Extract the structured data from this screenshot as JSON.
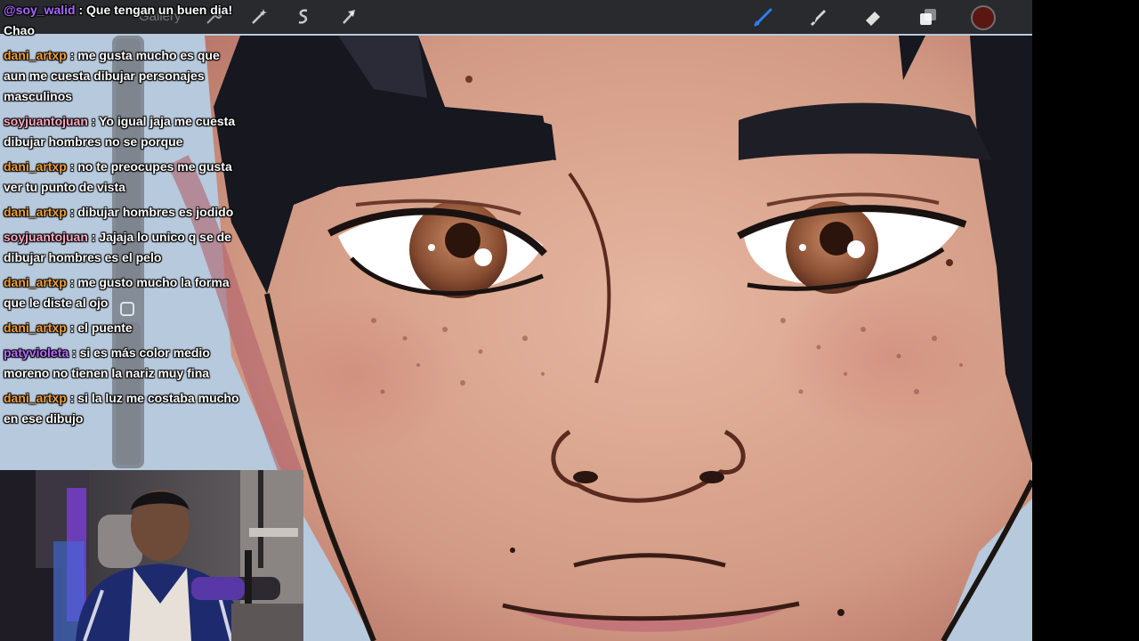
{
  "toolbar": {
    "gallery_label": "Gallery",
    "left_icons": [
      "wrench-icon",
      "magic-wand-icon",
      "selection-icon",
      "transform-arrow-icon"
    ],
    "right_icons": [
      "brush-icon",
      "smudge-icon",
      "eraser-icon",
      "layers-icon"
    ],
    "current_color": "#5a1610",
    "active_tool_color": "#2f7cf6"
  },
  "chat": {
    "messages": [
      {
        "user": "@soy_walid",
        "color": "#a968ff",
        "text": ": Que tengan un buen dia! Chao"
      },
      {
        "user": "dani_artxp",
        "color": "#f2a13a",
        "text": ": me gusta mucho es que aun me cuesta dibujar personajes masculinos"
      },
      {
        "user": "soyjuantojuan",
        "color": "#ffa9c4",
        "text": ": Yo igual jaja me cuesta dibujar hombres no se porque"
      },
      {
        "user": "dani_artxp",
        "color": "#f2a13a",
        "text": ": no te preocupes me gusta ver tu punto de vista"
      },
      {
        "user": "dani_artxp",
        "color": "#f2a13a",
        "text": ": dibujar hombres es jodido"
      },
      {
        "user": "soyjuantojuan",
        "color": "#ffa9c4",
        "text": ": Jajaja lo unico q se de dibujar hombres es el pelo"
      },
      {
        "user": "dani_artxp",
        "color": "#f2a13a",
        "text": ": me gusto mucho la forma que le diste al ojo"
      },
      {
        "user": "dani_artxp",
        "color": "#f2a13a",
        "text": ": el puente"
      },
      {
        "user": "patyvioleta",
        "color": "#b86bff",
        "text": ": si es más color medio moreno no tienen la nariz muy fina"
      },
      {
        "user": "dani_artxp",
        "color": "#f2a13a",
        "text": ": si la luz me costaba mucho en ese dibujo"
      }
    ]
  },
  "colors": {
    "skin": "#d9a58f",
    "hair": "#16171f",
    "line": "#5a2a1e",
    "iris": "#8a4f33"
  }
}
